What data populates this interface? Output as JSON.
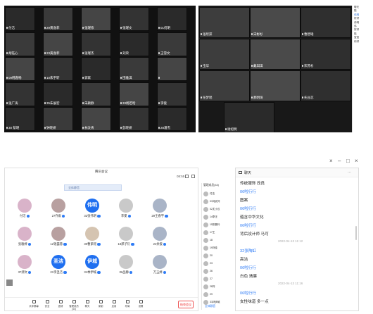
{
  "grid1": {
    "cells": [
      "付洁",
      "29黄逸菲",
      "张瑾侬",
      "张瑾文",
      "01何明",
      "胡钰心",
      "23黄逸菲",
      "张瑾杰",
      "刘荣",
      "王雪文",
      "09韩嘉畅",
      "10朱宇轩",
      "郭家",
      "田雅淇",
      "",
      "张广涛",
      "35朱展宏",
      "朱颖静",
      "33杨若晗",
      "李俊",
      "30 蔡明",
      "钟晓妍",
      "林汶青",
      "彭晓妍",
      "28潘杰"
    ]
  },
  "grid2": {
    "cells": [
      "张欣茹",
      "宋彬杉",
      "曹碧珺",
      "宝华",
      "戴琪琪",
      "宋苏杉",
      "任梦瑶",
      "郝明琦",
      "先豆芯",
      "谢绍明"
    ]
  },
  "sidechat": {
    "lines": [
      "聊天",
      "陪",
      "伟明",
      "",
      "好好",
      "",
      "伟明",
      "伟",
      "",
      "好好",
      "陪",
      "",
      "宝宝",
      "你好",
      "",
      ""
    ]
  },
  "meeting": {
    "title": "腾讯会议",
    "timer": "08:55",
    "subtitle": "全体静音",
    "attendees": [
      {
        "name": "付洁",
        "initials": "",
        "blue": false
      },
      {
        "name": "27乔雨",
        "initials": "",
        "blue": false
      },
      {
        "name": "32张伟明",
        "initials": "伟明",
        "blue": true
      },
      {
        "name": "李冕",
        "initials": "",
        "blue": false
      },
      {
        "name": "29王春宇",
        "initials": "",
        "blue": false
      },
      {
        "name": "张雅婷",
        "initials": "",
        "blue": false
      },
      {
        "name": "12钱露蓉",
        "initials": "",
        "blue": false
      },
      {
        "name": "30曹紫瑶",
        "initials": "",
        "blue": false
      },
      {
        "name": "18郝子衍",
        "initials": "",
        "blue": false
      },
      {
        "name": "24余俊",
        "initials": "",
        "blue": false
      },
      {
        "name": "37郝文",
        "initials": "",
        "blue": false
      },
      {
        "name": "21李圣洁",
        "initials": "圣洁",
        "blue": true
      },
      {
        "name": "31林伊城",
        "initials": "伊城",
        "blue": true
      },
      {
        "name": "06品静",
        "initials": "",
        "blue": false
      },
      {
        "name": "万玉婷",
        "initials": "",
        "blue": false
      }
    ],
    "toolbar": [
      "共享屏幕",
      "安全",
      "邀请",
      "管理成员(44)",
      "聊天",
      "录制",
      "应用",
      "布局",
      "设置"
    ],
    "end_label": "结束会议"
  },
  "plist": {
    "header": "管理成员(44)",
    "rows": [
      "付洁",
      "01何武刘",
      "02尤小汉",
      "14李汪",
      "15张晋玲",
      "17王",
      "18",
      "19刘佳",
      "20",
      "23",
      "26",
      "27",
      "28刘",
      "29",
      "31林伊城"
    ],
    "footer": "全体静音"
  },
  "chat": {
    "title": "聊天",
    "more": "…",
    "messages": [
      {
        "kind": "text",
        "text": "传统服饰 改良"
      },
      {
        "kind": "sender",
        "text": "06啦行行"
      },
      {
        "kind": "text",
        "text": "图案"
      },
      {
        "kind": "sender",
        "text": "06啦行行"
      },
      {
        "kind": "text",
        "text": "蕴含中华文化"
      },
      {
        "kind": "sender",
        "text": "06啦行行"
      },
      {
        "kind": "text",
        "text": "背后设计师 马可"
      },
      {
        "kind": "time",
        "text": "2022-04-13 11:12"
      },
      {
        "kind": "sender",
        "text": "32张陶虹"
      },
      {
        "kind": "text",
        "text": "高洁"
      },
      {
        "kind": "sender",
        "text": "06啦行行"
      },
      {
        "kind": "text",
        "text": "白色 清廉"
      },
      {
        "kind": "time",
        "text": "2022-04-13 11:16"
      },
      {
        "kind": "sender",
        "text": "06啦行行"
      },
      {
        "kind": "text",
        "text": "女性味道 多一点"
      }
    ]
  },
  "window_controls": [
    "×",
    "–",
    "□",
    "×"
  ],
  "colors": {
    "accent": "#2f7cf6",
    "grid_bg": "#111111",
    "end": "#ee3333"
  }
}
